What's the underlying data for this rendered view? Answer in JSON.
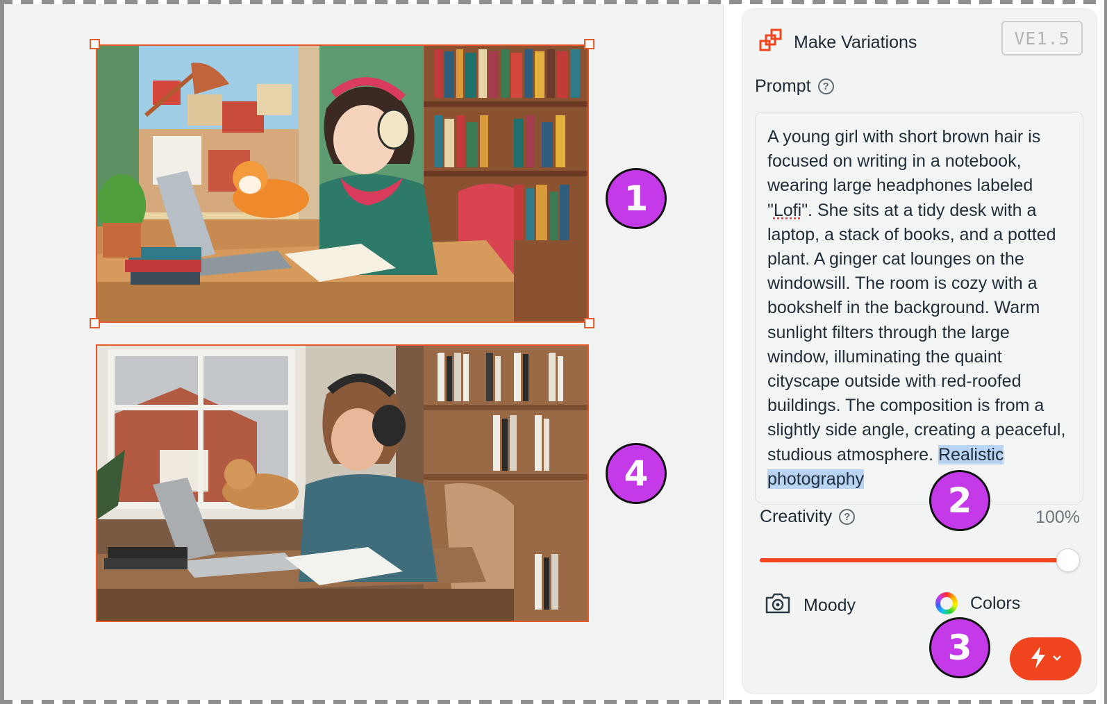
{
  "panel": {
    "title": "Make Variations",
    "version": "VE1.5",
    "prompt_label": "Prompt",
    "help_glyph": "?",
    "prompt_text_main": "A young girl with short brown hair is focused on writing in a notebook, wearing large headphones labeled \"",
    "prompt_text_lofi": "Lofi",
    "prompt_text_rest": "\". She sits at a tidy desk with a laptop, a stack of books, and a potted plant. A ginger cat lounges on the windowsill. The room is cozy with a bookshelf in the background. Warm sunlight filters through the large window, illuminating the quaint cityscape outside with red-roofed buildings. The composition is from a slightly side angle, creating a peaceful, studious atmosphere. ",
    "prompt_text_selected": "Realistic photography",
    "creativity_label": "Creativity",
    "creativity_value": "100%",
    "creativity_level": 1.0,
    "moody_label": "Moody",
    "colors_label": "Colors"
  },
  "annotations": {
    "badge_1": "1",
    "badge_2": "2",
    "badge_3": "3",
    "badge_4": "4"
  },
  "colors": {
    "accent": "#f0441e",
    "badge": "#c43ae8",
    "selection": "#e85a2a"
  },
  "icons": {
    "variations": "variations-icon",
    "camera": "camera-icon",
    "colors": "color-wheel-icon",
    "bolt": "lightning-icon",
    "chevron": "chevron-down-icon"
  }
}
